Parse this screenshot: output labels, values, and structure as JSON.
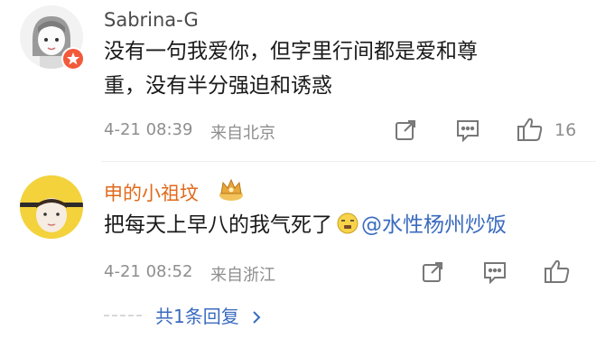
{
  "comments": [
    {
      "username": "Sabrina-G",
      "text_lines": [
        "没有一句我爱你，但字里行间都是爱和尊",
        "重，没有半分强迫和诱惑"
      ],
      "timestamp": "4-21 08:39",
      "location": "来自北京",
      "like_count": "16",
      "avatar_icon": "cartoon-girl-avatar",
      "badge_icon": "red-star-badge"
    },
    {
      "username": "申的小祖坟",
      "username_badge_icon": "gold-crown-badge",
      "text": "把每天上早八的我气死了",
      "emoji_icon": "yawn-emoji",
      "mention": "@水性杨州炒饭",
      "timestamp": "4-21 08:52",
      "location": "来自浙江",
      "avatar_icon": "yellow-hood-avatar",
      "replies_label": "共1条回复"
    }
  ],
  "colors": {
    "username_1": "#4a4a4a",
    "username_2": "#e06a1b",
    "meta": "#8e8e8e",
    "link": "#3a6bbf"
  }
}
